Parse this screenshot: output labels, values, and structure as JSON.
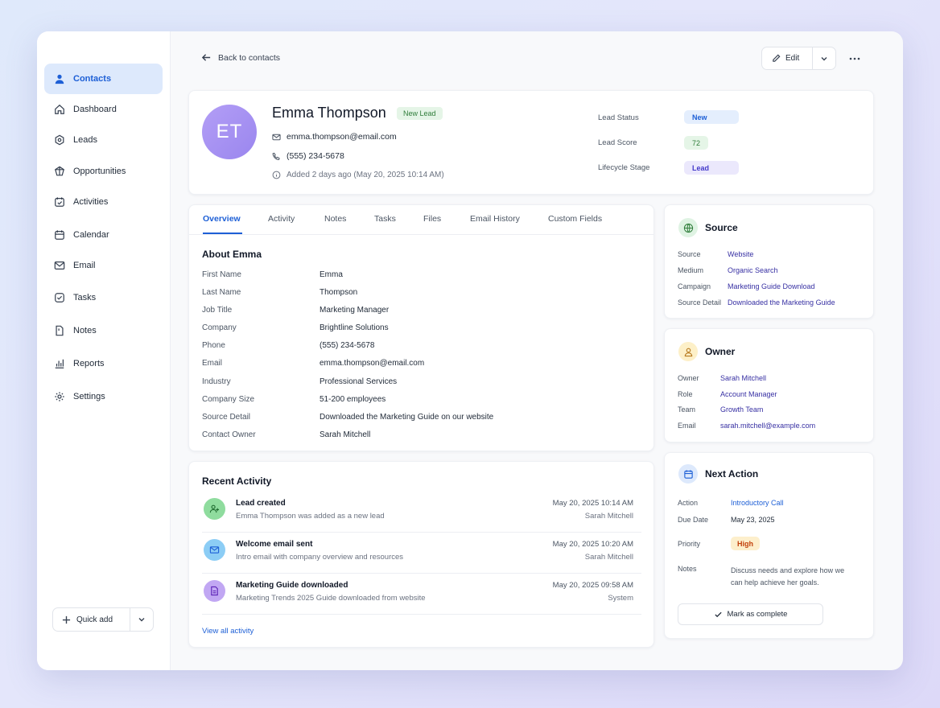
{
  "sidebar": {
    "items": [
      {
        "label": "Contacts",
        "icon": "user-icon",
        "active": true
      },
      {
        "label": "Dashboard",
        "icon": "home-icon"
      },
      {
        "label": "Leads",
        "icon": "hexagon-icon"
      },
      {
        "label": "Opportunities",
        "icon": "gem-icon"
      },
      {
        "label": "Activities",
        "icon": "calendar-check-icon"
      },
      {
        "label": "Calendar",
        "icon": "calendar-icon"
      },
      {
        "label": "Email",
        "icon": "mail-icon"
      },
      {
        "label": "Tasks",
        "icon": "check-square-icon"
      },
      {
        "label": "Notes",
        "icon": "note-icon"
      },
      {
        "label": "Reports",
        "icon": "chart-icon"
      },
      {
        "label": "Settings",
        "icon": "gear-icon"
      }
    ],
    "quick_add_label": "Quick add"
  },
  "header": {
    "back_label": "Back to contacts",
    "edit_label": "Edit"
  },
  "profile": {
    "initials": "ET",
    "name": "Emma Thompson",
    "badge": "New Lead",
    "email": "emma.thompson@email.com",
    "phone": "(555) 234-5678",
    "added": "Added 2 days ago (May 20, 2025 10:14 AM)",
    "status": [
      {
        "label": "Lead Status",
        "value": "New"
      },
      {
        "label": "Lead Score",
        "value": "72"
      },
      {
        "label": "Lifecycle Stage",
        "value": "Lead"
      }
    ]
  },
  "tabs": [
    "Overview",
    "Activity",
    "Notes",
    "Tasks",
    "Files",
    "Email History",
    "Custom Fields"
  ],
  "about": {
    "title": "About Emma",
    "fields": [
      {
        "label": "First Name",
        "value": "Emma"
      },
      {
        "label": "Last Name",
        "value": "Thompson"
      },
      {
        "label": "Job Title",
        "value": "Marketing Manager"
      },
      {
        "label": "Company",
        "value": "Brightline Solutions"
      },
      {
        "label": "Phone",
        "value": "(555) 234-5678"
      },
      {
        "label": "Email",
        "value": "emma.thompson@email.com"
      },
      {
        "label": "Industry",
        "value": "Professional Services"
      },
      {
        "label": "Company Size",
        "value": "51-200 employees"
      },
      {
        "label": "Source Detail",
        "value": "Downloaded the Marketing Guide on our website"
      },
      {
        "label": "Contact Owner",
        "value": "Sarah Mitchell"
      }
    ]
  },
  "activity": {
    "title": "Recent Activity",
    "items": [
      {
        "title": "Lead created",
        "desc": "Emma Thompson was added as a new lead",
        "time": "May 20, 2025 10:14 AM",
        "user": "Sarah Mitchell",
        "icon": "user-plus-icon"
      },
      {
        "title": "Welcome email sent",
        "desc": "Intro email with company overview and resources",
        "time": "May 20, 2025 10:20 AM",
        "user": "Sarah Mitchell",
        "icon": "mail-icon"
      },
      {
        "title": "Marketing Guide downloaded",
        "desc": "Marketing Trends 2025 Guide downloaded from website",
        "time": "May 20, 2025 09:58 AM",
        "user": "System",
        "icon": "document-icon"
      }
    ],
    "view_all": "View all activity"
  },
  "source": {
    "title": "Source",
    "rows": [
      {
        "label": "Source",
        "value": "Website"
      },
      {
        "label": "Medium",
        "value": "Organic Search"
      },
      {
        "label": "Campaign",
        "value": "Marketing Guide Download"
      },
      {
        "label": "Source Detail",
        "value": "Downloaded the Marketing Guide"
      }
    ]
  },
  "owner": {
    "title": "Owner",
    "rows": [
      {
        "label": "Owner",
        "value": "Sarah Mitchell"
      },
      {
        "label": "Role",
        "value": "Account Manager"
      },
      {
        "label": "Team",
        "value": "Growth Team"
      },
      {
        "label": "Email",
        "value": "sarah.mitchell@example.com"
      }
    ]
  },
  "next_action": {
    "title": "Next Action",
    "action_label": "Action",
    "action_value": "Introductory Call",
    "due_label": "Due Date",
    "due_value": "May 23, 2025",
    "priority_label": "Priority",
    "priority_value": "High",
    "notes_label": "Notes",
    "notes_value": "Discuss needs and explore how we can help achieve her goals.",
    "complete_label": "Mark as complete"
  },
  "colors": {
    "accent": "#1d5fd6",
    "link": "#3730a3",
    "badge_green_bg": "#e5f5e7",
    "avatar": "#a593f3"
  }
}
